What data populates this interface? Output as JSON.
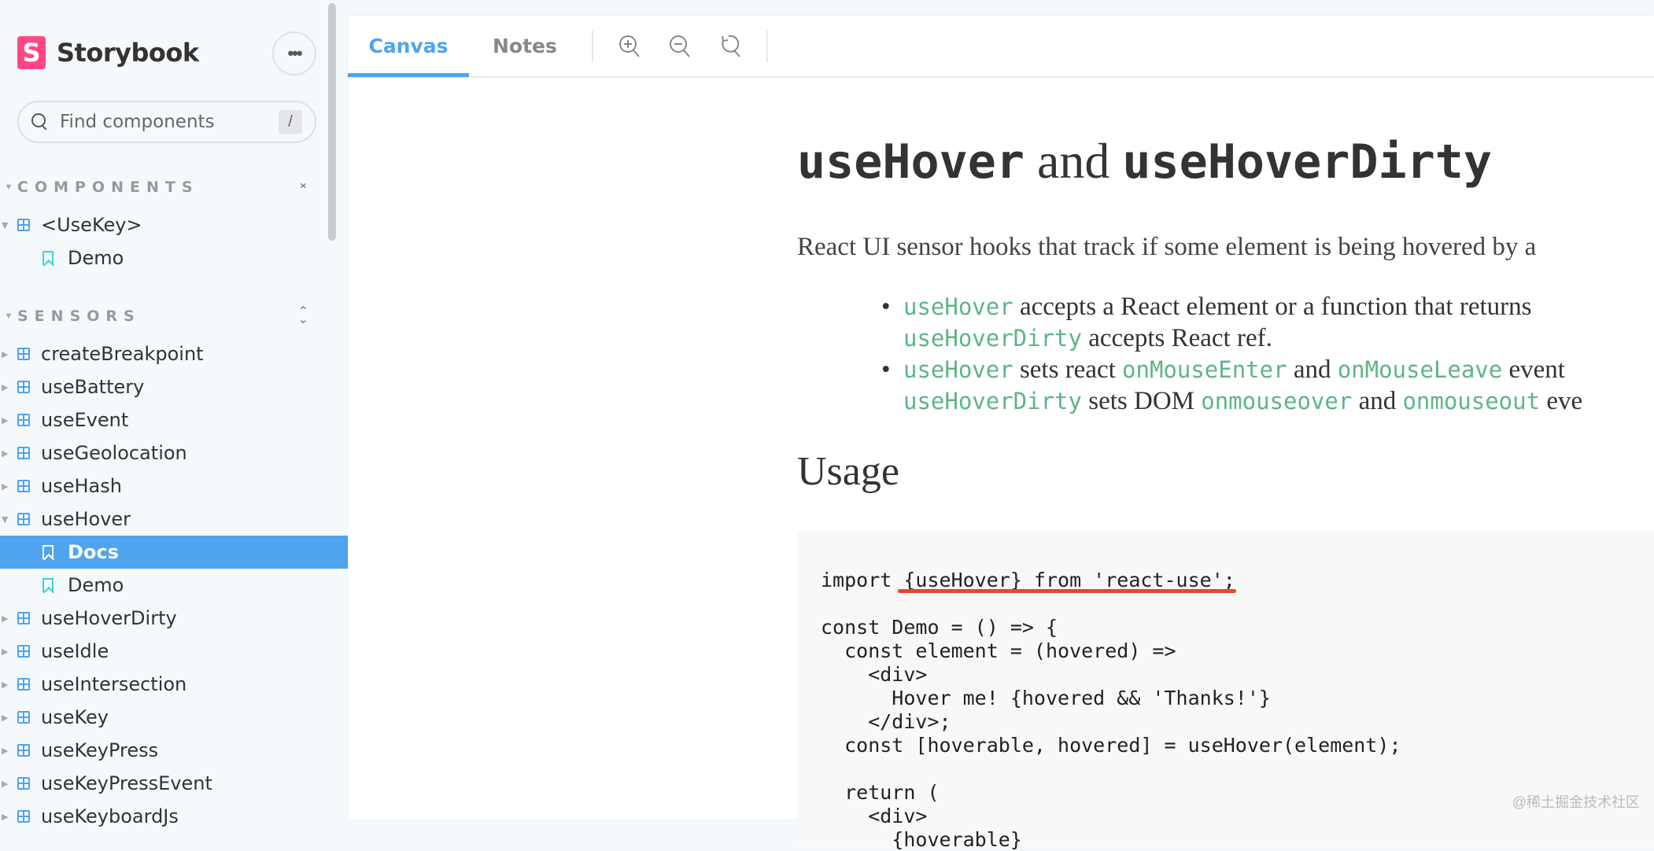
{
  "sidebar": {
    "logo_letter": "S",
    "brand": "Storybook",
    "more_label": "•••",
    "search_placeholder": "Find components",
    "search_shortcut": "/",
    "sections": [
      {
        "title": "COMPONENTS",
        "items": [
          {
            "label": "<UseKey>"
          },
          {
            "label": "Demo"
          }
        ]
      },
      {
        "title": "SENSORS",
        "items": [
          {
            "label": "createBreakpoint"
          },
          {
            "label": "useBattery"
          },
          {
            "label": "useEvent"
          },
          {
            "label": "useGeolocation"
          },
          {
            "label": "useHash"
          },
          {
            "label": "useHover"
          },
          {
            "label": "Docs"
          },
          {
            "label": "Demo"
          },
          {
            "label": "useHoverDirty"
          },
          {
            "label": "useIdle"
          },
          {
            "label": "useIntersection"
          },
          {
            "label": "useKey"
          },
          {
            "label": "useKeyPress"
          },
          {
            "label": "useKeyPressEvent"
          },
          {
            "label": "useKeyboardJs"
          }
        ]
      }
    ]
  },
  "toolbar": {
    "tabs": [
      {
        "label": "Canvas"
      },
      {
        "label": "Notes"
      }
    ]
  },
  "doc": {
    "title": {
      "a": "useHover",
      "and": " and ",
      "b": "useHoverDirty"
    },
    "lead": "React UI sensor hooks that track if some element is being hovered by a",
    "bullets": [
      {
        "c1": "useHover",
        "t1": " accepts a React element or a function that returns",
        "c2": "useHoverDirty",
        "t2": " accepts React ref."
      },
      {
        "c1": "useHover",
        "t1": " sets react ",
        "c2": "onMouseEnter",
        "t2": " and ",
        "c3": "onMouseLeave",
        "t3": " event",
        "c4": "useHoverDirty",
        "t4": " sets DOM ",
        "c5": "onmouseover",
        "t5": " and ",
        "c6": "onmouseout",
        "t6": " eve"
      }
    ],
    "usage": "Usage",
    "code": [
      "import {useHover} from 'react-use';",
      "",
      "const Demo = () => {",
      "  const element = (hovered) =>",
      "    <div>",
      "      Hover me! {hovered && 'Thanks!'}",
      "    </div>;",
      "  const [hoverable, hovered] = useHover(element);",
      "",
      "  return (",
      "    <div>",
      "      {hoverable}"
    ]
  },
  "watermark": "@稀土掘金技术社区",
  "colors": {
    "accent": "#4ea4ef",
    "brand": "#ff4785",
    "code_inline": "#5db588",
    "highlight": "#e7472b"
  }
}
